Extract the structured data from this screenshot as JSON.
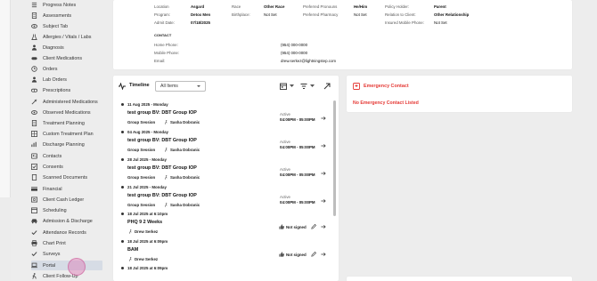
{
  "sidebar": {
    "items": [
      {
        "label": "Progress Notes",
        "icon": "list-icon"
      },
      {
        "label": "Assessments",
        "icon": "document-icon"
      },
      {
        "label": "Subject Tab",
        "icon": "eye-icon"
      },
      {
        "label": "Allergies / Vitals / Labs",
        "icon": "flask-icon"
      },
      {
        "label": "Diagnosis",
        "icon": "person-icon"
      },
      {
        "label": "Client Medications",
        "icon": "pill-icon"
      },
      {
        "label": "Orders",
        "icon": "clock-icon"
      },
      {
        "label": "Lab Orders",
        "icon": "person-icon"
      },
      {
        "label": "Prescriptions",
        "icon": "pill-icon"
      },
      {
        "label": "Administered Medications",
        "icon": "syringe-icon"
      },
      {
        "label": "Observed Medications",
        "icon": "eye-icon"
      },
      {
        "label": "Treatment Planning",
        "icon": "document-icon"
      },
      {
        "label": "Custom Treatment Plan",
        "icon": "grid-icon"
      },
      {
        "label": "Discharge Planning",
        "icon": "chart-icon"
      },
      {
        "label": "Contacts",
        "icon": "contact-icon"
      },
      {
        "label": "Consents",
        "icon": "check-box-icon"
      },
      {
        "label": "Scanned Documents",
        "icon": "document-icon"
      },
      {
        "label": "Financial",
        "icon": "card-icon"
      },
      {
        "label": "Client Cash Ledger",
        "icon": "ledger-icon"
      },
      {
        "label": "Scheduling",
        "icon": "calendar-icon"
      },
      {
        "label": "Admission & Discharge",
        "icon": "car-icon"
      },
      {
        "label": "Attendance Records",
        "icon": "check-icon"
      },
      {
        "label": "Chart Print",
        "icon": "printer-icon"
      },
      {
        "label": "Surveys",
        "icon": "check-icon"
      },
      {
        "label": "Portal",
        "icon": "laptop-icon"
      },
      {
        "label": "Client Follow-Up",
        "icon": "person-walk-icon"
      }
    ]
  },
  "info": {
    "location_label": "Location",
    "location_value": "Asgard",
    "program_label": "Program:",
    "program_value": "Detox Men",
    "admit_label": "Admit Date:",
    "admit_value": "07/18/2025",
    "race_label": "Race",
    "race_value": "Other Race",
    "birthplace_label": "Birthplace:",
    "birthplace_value": "Not Set",
    "pronouns_label": "Preferred Pronouns",
    "pronouns_value": "He/Him",
    "pharmacy_label": "Preferred Pharmacy",
    "pharmacy_value": "Not Set",
    "policy_holder_label": "Policy Holder:",
    "policy_holder_value": "Parent",
    "relation_label": "Relation to Client:",
    "relation_value": "Other Relationship",
    "insured_mobile_label": "Insured Mobile Phone:",
    "insured_mobile_value": "Not Set",
    "contact_header": "CONTACT",
    "home_phone_label": "Home Phone:",
    "home_phone_value": "(954) 000-0000",
    "mobile_phone_label": "Mobile Phone:",
    "mobile_phone_value": "(954) 000-0000",
    "email_label": "Email:",
    "email_value": "drew.serkez@lightningstep.com"
  },
  "timeline": {
    "title": "Timeline",
    "filter_value": "All Items",
    "events": [
      {
        "date": "11 Aug 2025 - Monday",
        "title": "test group BV: DBT Group IOP",
        "sub": "Group Session",
        "person": "Sasha Dobranic",
        "status": "Active",
        "time": "04:00PM - 05:00PM"
      },
      {
        "date": "04 Aug 2025 - Monday",
        "title": "test group BV: DBT Group IOP",
        "sub": "Group Session",
        "person": "Sasha Dobranic",
        "status": "Active",
        "time": "04:00PM - 05:00PM"
      },
      {
        "date": "28 Jul 2025 - Monday",
        "title": "test group BV: DBT Group IOP",
        "sub": "Group Session",
        "person": "Sasha Dobranic",
        "status": "Active",
        "time": "04:00PM - 05:00PM"
      },
      {
        "date": "21 Jul 2025 - Monday",
        "title": "test group BV: DBT Group IOP",
        "sub": "Group Session",
        "person": "Sasha Dobranic",
        "status": "Active",
        "time": "04:00PM - 05:00PM"
      },
      {
        "date": "18 Jul 2025 at 6:10pm",
        "title": "PHQ 9 2 Weeks",
        "person": "Drew Serkez",
        "status": "Not signed"
      },
      {
        "date": "18 Jul 2025 at 6:09pm",
        "title": "BAM",
        "person": "Drew Serkez",
        "status": "Not signed"
      },
      {
        "date": "18 Jul 2025 at 6:09pm"
      }
    ]
  },
  "emergency": {
    "title": "Emergency Contact",
    "message": "No Emergency Contact Listed"
  },
  "colors": {
    "accent_red": "#e53935",
    "active_nav": "#d6dce5"
  }
}
